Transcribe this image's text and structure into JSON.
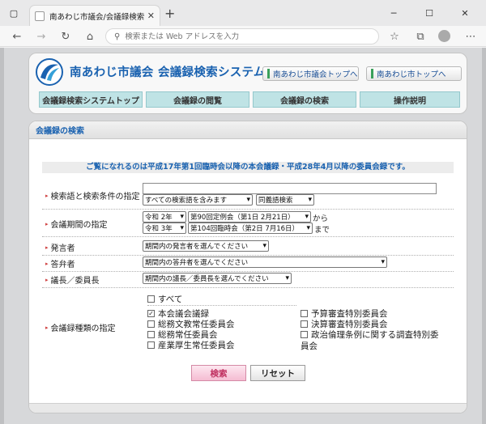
{
  "browser": {
    "tab_title": "南あわじ市議会/会議録検索システム",
    "address_placeholder": "検索または Web アドレスを入力"
  },
  "header": {
    "site_title": "南あわじ市議会 会議録検索システム",
    "link_council_top": "南あわじ市議会トップへ",
    "link_city_top": "南あわじ市トップへ"
  },
  "nav": {
    "tabs": [
      "会議録検索システムトップ",
      "会議録の閲覧",
      "会議録の検索",
      "操作説明"
    ]
  },
  "search": {
    "heading": "会議録の検索",
    "notice": "ご覧になれるのは平成17年第1回臨時会以降の本会議録・平成28年4月以降の委員会録です。",
    "keyword": {
      "label": "検索語と検索条件の指定",
      "value": "",
      "mode": "すべての検索語を含みます",
      "synonym": "同義語検索"
    },
    "period": {
      "label": "会議期間の指定",
      "from_year": "令和 2年",
      "from_session": "第90回定例会（第1日 2月21日）",
      "from_suffix": "から",
      "to_year": "令和 3年",
      "to_session": "第104回臨時会（第2日 7月16日）",
      "to_suffix": "まで"
    },
    "speaker": {
      "label": "発言者",
      "value": "期間内の発言者を選んでください"
    },
    "answerer": {
      "label": "答弁者",
      "value": "期間内の答弁者を選んでください"
    },
    "chair": {
      "label": "議長／委員長",
      "value": "期間内の議長／委員長を選んでください"
    },
    "types": {
      "label": "会議録種類の指定",
      "all": "すべて",
      "left": [
        {
          "label": "本会議会議録",
          "checked": "✓"
        },
        {
          "label": "総務文教常任委員会",
          "checked": ""
        },
        {
          "label": "総務常任委員会",
          "checked": ""
        },
        {
          "label": "産業厚生常任委員会",
          "checked": ""
        }
      ],
      "right": [
        {
          "label": "予算審査特別委員会",
          "checked": ""
        },
        {
          "label": "決算審査特別委員会",
          "checked": ""
        },
        {
          "label": "政治倫理条例に関する調査特別委",
          "checked": ""
        }
      ],
      "right_wrap": "員会"
    },
    "submit_label": "検索",
    "reset_label": "リセット"
  }
}
